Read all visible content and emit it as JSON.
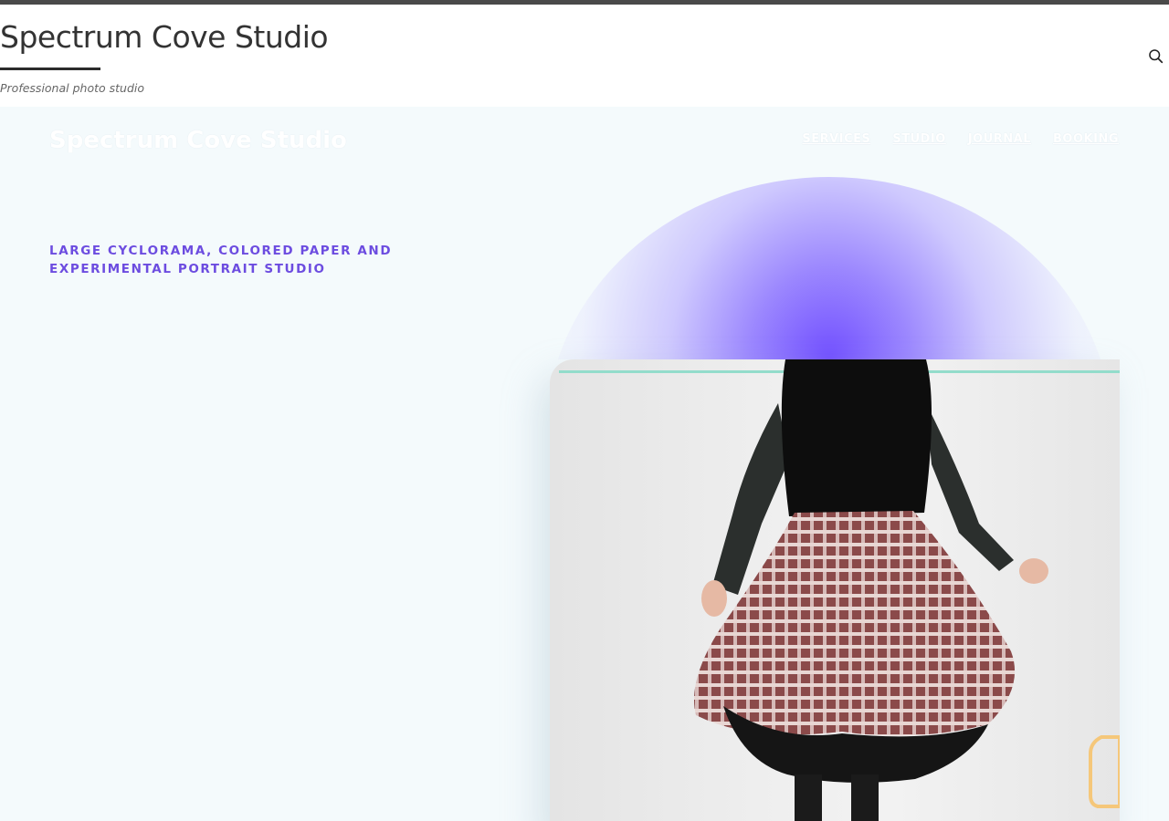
{
  "header": {
    "site_title": "Spectrum Cove Studio",
    "tagline": "Professional photo studio",
    "search_icon": "search-icon"
  },
  "hero": {
    "brand": "Spectrum Cove Studio",
    "nav": [
      {
        "label": "SERVICES"
      },
      {
        "label": "STUDIO"
      },
      {
        "label": "JOURNAL"
      },
      {
        "label": "BOOKING"
      }
    ],
    "kicker": "LARGE CYCLORAMA, COLORED PAPER AND EXPERIMENTAL PORTRAIT STUDIO"
  },
  "colors": {
    "accent": "#6c4ce0",
    "glow": "#7b55ff",
    "background": "#f4fafc",
    "header_stripe": "#4a4a4a",
    "teal_line": "#93dccb"
  }
}
